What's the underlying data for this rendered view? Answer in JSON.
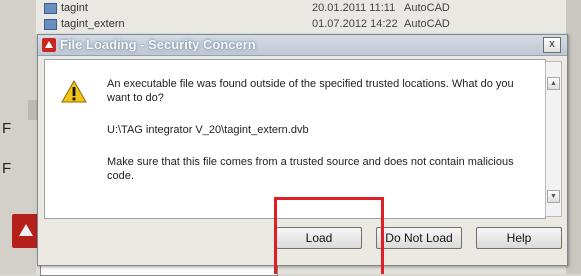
{
  "background": {
    "rows": [
      {
        "name": "tagint",
        "date": "20.01.2011 11:11",
        "type": "AutoCAD"
      },
      {
        "name": "tagint_extern",
        "date": "01.07.2012 14:22",
        "type": "AutoCAD"
      }
    ],
    "left_letters": [
      "F",
      "F"
    ]
  },
  "dialog": {
    "title": "File Loading - Security Concern",
    "close_glyph": "x",
    "message_line1": "An executable file was found outside of the specified trusted locations.  What do you want to do?",
    "file_path": "U:\\TAG integrator V_20\\tagint_extern.dvb",
    "message_line2": "Make sure that this file comes from a trusted source and does not contain malicious code.",
    "scroll_up": "▲",
    "scroll_down": "▼",
    "buttons": {
      "load": "Load",
      "do_not_load": "Do Not Load",
      "help": "Help"
    }
  },
  "icons": {
    "app": "autocad-icon",
    "warning": "warning-icon"
  },
  "colors": {
    "highlight": "#e11d26",
    "warning": "#f3c318",
    "brand": "#c8261e"
  }
}
